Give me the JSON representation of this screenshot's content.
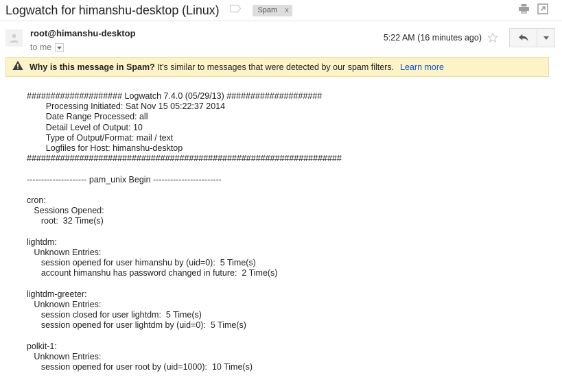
{
  "subject": {
    "title": "Logwatch for himanshu-desktop (Linux)",
    "label_icon": "label-tag-icon",
    "spam_label": "Spam",
    "spam_remove": "x",
    "print_icon": "printer-icon",
    "popout_icon": "open-in-new-window-icon"
  },
  "header": {
    "avatar_icon": "person-avatar-icon",
    "sender": "root@himanshu-desktop",
    "recipient": "to me",
    "recipient_caret_icon": "chevron-down-icon",
    "timestamp": "5:22 AM (16 minutes ago)",
    "star_icon": "star-outline-icon",
    "reply_icon": "reply-arrow-icon",
    "more_icon": "chevron-down-icon"
  },
  "spam_banner": {
    "warning_icon": "warning-triangle-icon",
    "question": "Why is this message in Spam?",
    "explanation": "It's similar to messages that were detected by our spam filters.",
    "link": "Learn more",
    "bg_color": "#fdf3c8",
    "border_color": "#e8dba0",
    "link_color": "#1155cc"
  },
  "body": {
    "text": "#################### Logwatch 7.4.0 (05/29/13) ####################\n        Processing Initiated: Sat Nov 15 05:22:37 2014\n        Date Range Processed: all\n        Detail Level of Output: 10\n        Type of Output/Format: mail / text\n        Logfiles for Host: himanshu-desktop\n##################################################################\n\n--------------------- pam_unix Begin ------------------------\n\ncron:\n   Sessions Opened:\n      root:  32 Time(s)\n\nlightdm:\n   Unknown Entries:\n      session opened for user himanshu by (uid=0):  5 Time(s)\n      account himanshu has password changed in future:  2 Time(s)\n\nlightdm-greeter:\n   Unknown Entries:\n      session closed for user lightdm:  5 Time(s)\n      session opened for user lightdm by (uid=0):  5 Time(s)\n\npolkit-1:\n   Unknown Entries:\n      session opened for user root by (uid=1000):  10 Time(s)"
  }
}
